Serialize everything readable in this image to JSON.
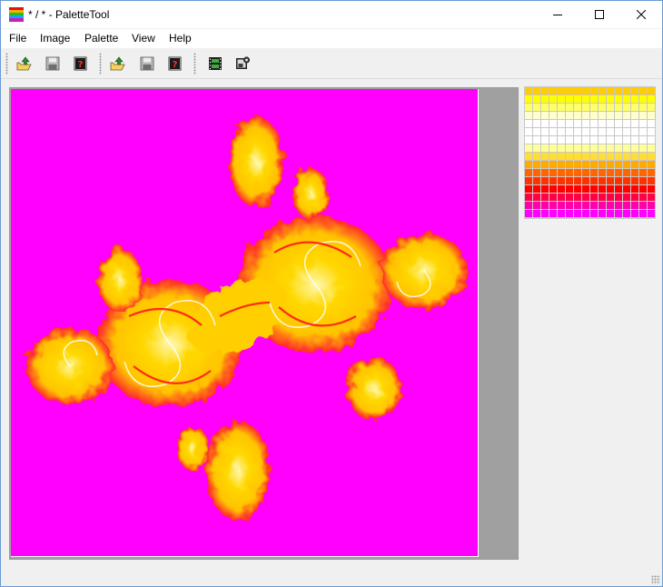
{
  "window": {
    "title": "* / * - PaletteTool"
  },
  "menu": [
    {
      "label": "File"
    },
    {
      "label": "Image"
    },
    {
      "label": "Palette"
    },
    {
      "label": "View"
    },
    {
      "label": "Help"
    }
  ],
  "toolbar": {
    "groups": [
      [
        "open-image-icon",
        "save-image-icon",
        "image-info-icon"
      ],
      [
        "open-palette-icon",
        "save-palette-icon",
        "palette-info-icon"
      ],
      [
        "animation-film-icon",
        "export-settings-icon"
      ]
    ]
  },
  "image": {
    "description_colors": {
      "background": "#ff00ff",
      "fractal_primary": "#ffd800",
      "fractal_edge": "#ff1a1a",
      "fractal_highlight": "#ffffff"
    }
  },
  "palette": {
    "columns": 16,
    "rows": 16,
    "row_colors": [
      "#ffcc00",
      "#ffff00",
      "#ffff66",
      "#ffffcc",
      "#ffffff",
      "#ffffff",
      "#ffffff",
      "#ffff99",
      "#ffdd33",
      "#ffaa00",
      "#ff6600",
      "#ff3300",
      "#ff0000",
      "#ff0044",
      "#ff00aa",
      "#ff00ff"
    ]
  }
}
